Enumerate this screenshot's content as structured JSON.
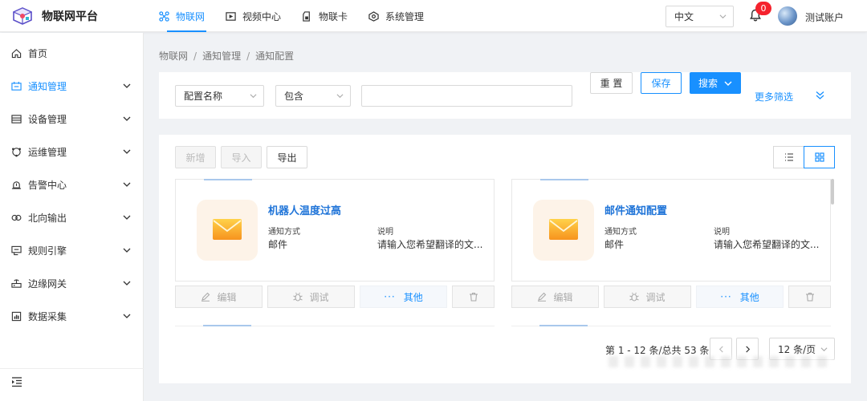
{
  "app": {
    "title": "物联网平台"
  },
  "topnav": [
    {
      "label": "物联网",
      "icon": "iot-icon",
      "active": true
    },
    {
      "label": "视频中心",
      "icon": "video-icon",
      "active": false
    },
    {
      "label": "物联卡",
      "icon": "sim-card-icon",
      "active": false
    },
    {
      "label": "系统管理",
      "icon": "system-icon",
      "active": false
    }
  ],
  "header": {
    "language": "中文",
    "notification_count": "0",
    "user": "测试账户"
  },
  "sidebar": {
    "items": [
      {
        "label": "首页",
        "icon": "home-icon"
      },
      {
        "label": "通知管理",
        "icon": "notice-icon",
        "active": true
      },
      {
        "label": "设备管理",
        "icon": "device-icon"
      },
      {
        "label": "运维管理",
        "icon": "ops-icon"
      },
      {
        "label": "告警中心",
        "icon": "alarm-icon"
      },
      {
        "label": "北向输出",
        "icon": "output-icon"
      },
      {
        "label": "规则引擎",
        "icon": "rule-icon"
      },
      {
        "label": "边缘网关",
        "icon": "gateway-icon"
      },
      {
        "label": "数据采集",
        "icon": "collect-icon"
      }
    ]
  },
  "breadcrumb": [
    "物联网",
    "通知管理",
    "通知配置"
  ],
  "filter": {
    "field": "配置名称",
    "operator": "包含",
    "value": "",
    "reset": "重 置",
    "save": "保存",
    "search": "搜索",
    "more": "更多筛选"
  },
  "toolbar": {
    "add": "新增",
    "import": "导入",
    "export": "导出"
  },
  "cards": [
    {
      "title": "机器人温度过高",
      "type_label": "通知方式",
      "type_value": "邮件",
      "desc_label": "说明",
      "desc_value": "请输入您希望翻译的文..."
    },
    {
      "title": "邮件通知配置",
      "type_label": "通知方式",
      "type_value": "邮件",
      "desc_label": "说明",
      "desc_value": "请输入您希望翻译的文..."
    }
  ],
  "card_actions": {
    "edit": "编辑",
    "debug": "调试",
    "more": "其他",
    "more_dots": "···"
  },
  "pagination": {
    "summary": "第 1 - 12 条/总共 53 条",
    "page_size": "12 条/页"
  },
  "colors": {
    "primary": "#1890ff",
    "badge": "#f5222d"
  }
}
